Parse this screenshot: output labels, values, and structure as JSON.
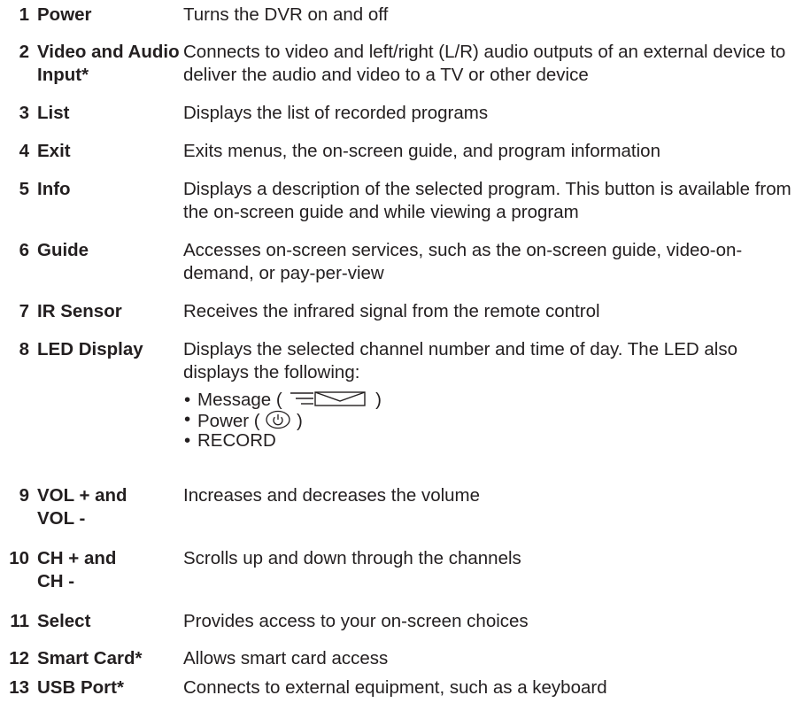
{
  "items": [
    {
      "num": "1",
      "label": "Power",
      "desc": "Turns the DVR on and off"
    },
    {
      "num": "2",
      "label": "Video and Audio Input*",
      "desc": "Connects to video and left/right (L/R) audio outputs of an external device to deliver the audio and video to a TV or other device"
    },
    {
      "num": "3",
      "label": "List",
      "desc": "Displays the list of recorded programs"
    },
    {
      "num": "4",
      "label": "Exit",
      "desc": "Exits menus, the on-screen guide, and program information"
    },
    {
      "num": "5",
      "label": "Info",
      "desc": "Displays a description of the selected program. This button is available from the on-screen guide and while viewing a program"
    },
    {
      "num": "6",
      "label": "Guide",
      "desc": "Accesses on-screen services, such as the on-screen guide, video-on-demand, or pay-per-view"
    },
    {
      "num": "7",
      "label": "IR Sensor",
      "desc": "Receives the infrared signal from the remote control"
    },
    {
      "num": "8",
      "label": "LED Display",
      "desc": "Displays the selected channel number and time of day. The LED also displays the following:",
      "bullets": {
        "message_prefix": "Message (",
        "message_suffix": ")",
        "power_prefix": "Power (",
        "power_suffix": ")",
        "record": "RECORD"
      },
      "icons": [
        "message-lines-icon",
        "envelope-icon",
        "power-icon"
      ]
    },
    {
      "num": "9",
      "label": "VOL + and VOL -",
      "desc": "Increases and decreases the volume"
    },
    {
      "num": "10",
      "label": "CH + and CH -",
      "desc": "Scrolls up and down through the channels"
    },
    {
      "num": "11",
      "label": "Select",
      "desc": "Provides access to your on-screen choices"
    },
    {
      "num": "12",
      "label": "Smart Card*",
      "desc": "Allows smart card access"
    },
    {
      "num": "13",
      "label": "USB Port*",
      "desc": "Connects to external equipment, such as a keyboard"
    }
  ],
  "colors": {
    "text": "#231f20",
    "background": "#ffffff"
  }
}
